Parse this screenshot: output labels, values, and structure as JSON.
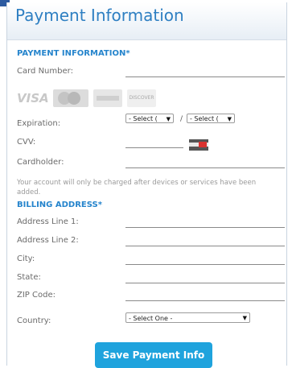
{
  "header": {
    "title": "Payment Information"
  },
  "payment": {
    "section_title": "PAYMENT INFORMATION*",
    "card_number_label": "Card Number:",
    "card_icons": [
      "VISA",
      "mastercard",
      "amex",
      "DISCOVER"
    ],
    "expiration_label": "Expiration:",
    "exp_month_value": "- Select (",
    "exp_year_value": "- Select (",
    "exp_separator": "/",
    "cvv_label": "CVV:",
    "cardholder_label": "Cardholder:",
    "note": "Your account will only be charged after devices or services have been added."
  },
  "billing": {
    "section_title": "BILLING ADDRESS*",
    "address1_label": "Address Line 1:",
    "address2_label": "Address Line 2:",
    "city_label": "City:",
    "state_label": "State:",
    "zip_label": "ZIP Code:",
    "country_label": "Country:",
    "country_value": "- Select One -"
  },
  "actions": {
    "save_label": "Save Payment Info"
  },
  "colors": {
    "title": "#2e7fc2",
    "section": "#2584cc",
    "button": "#1fa3dd",
    "accent_bar": "#2c5aa0"
  }
}
